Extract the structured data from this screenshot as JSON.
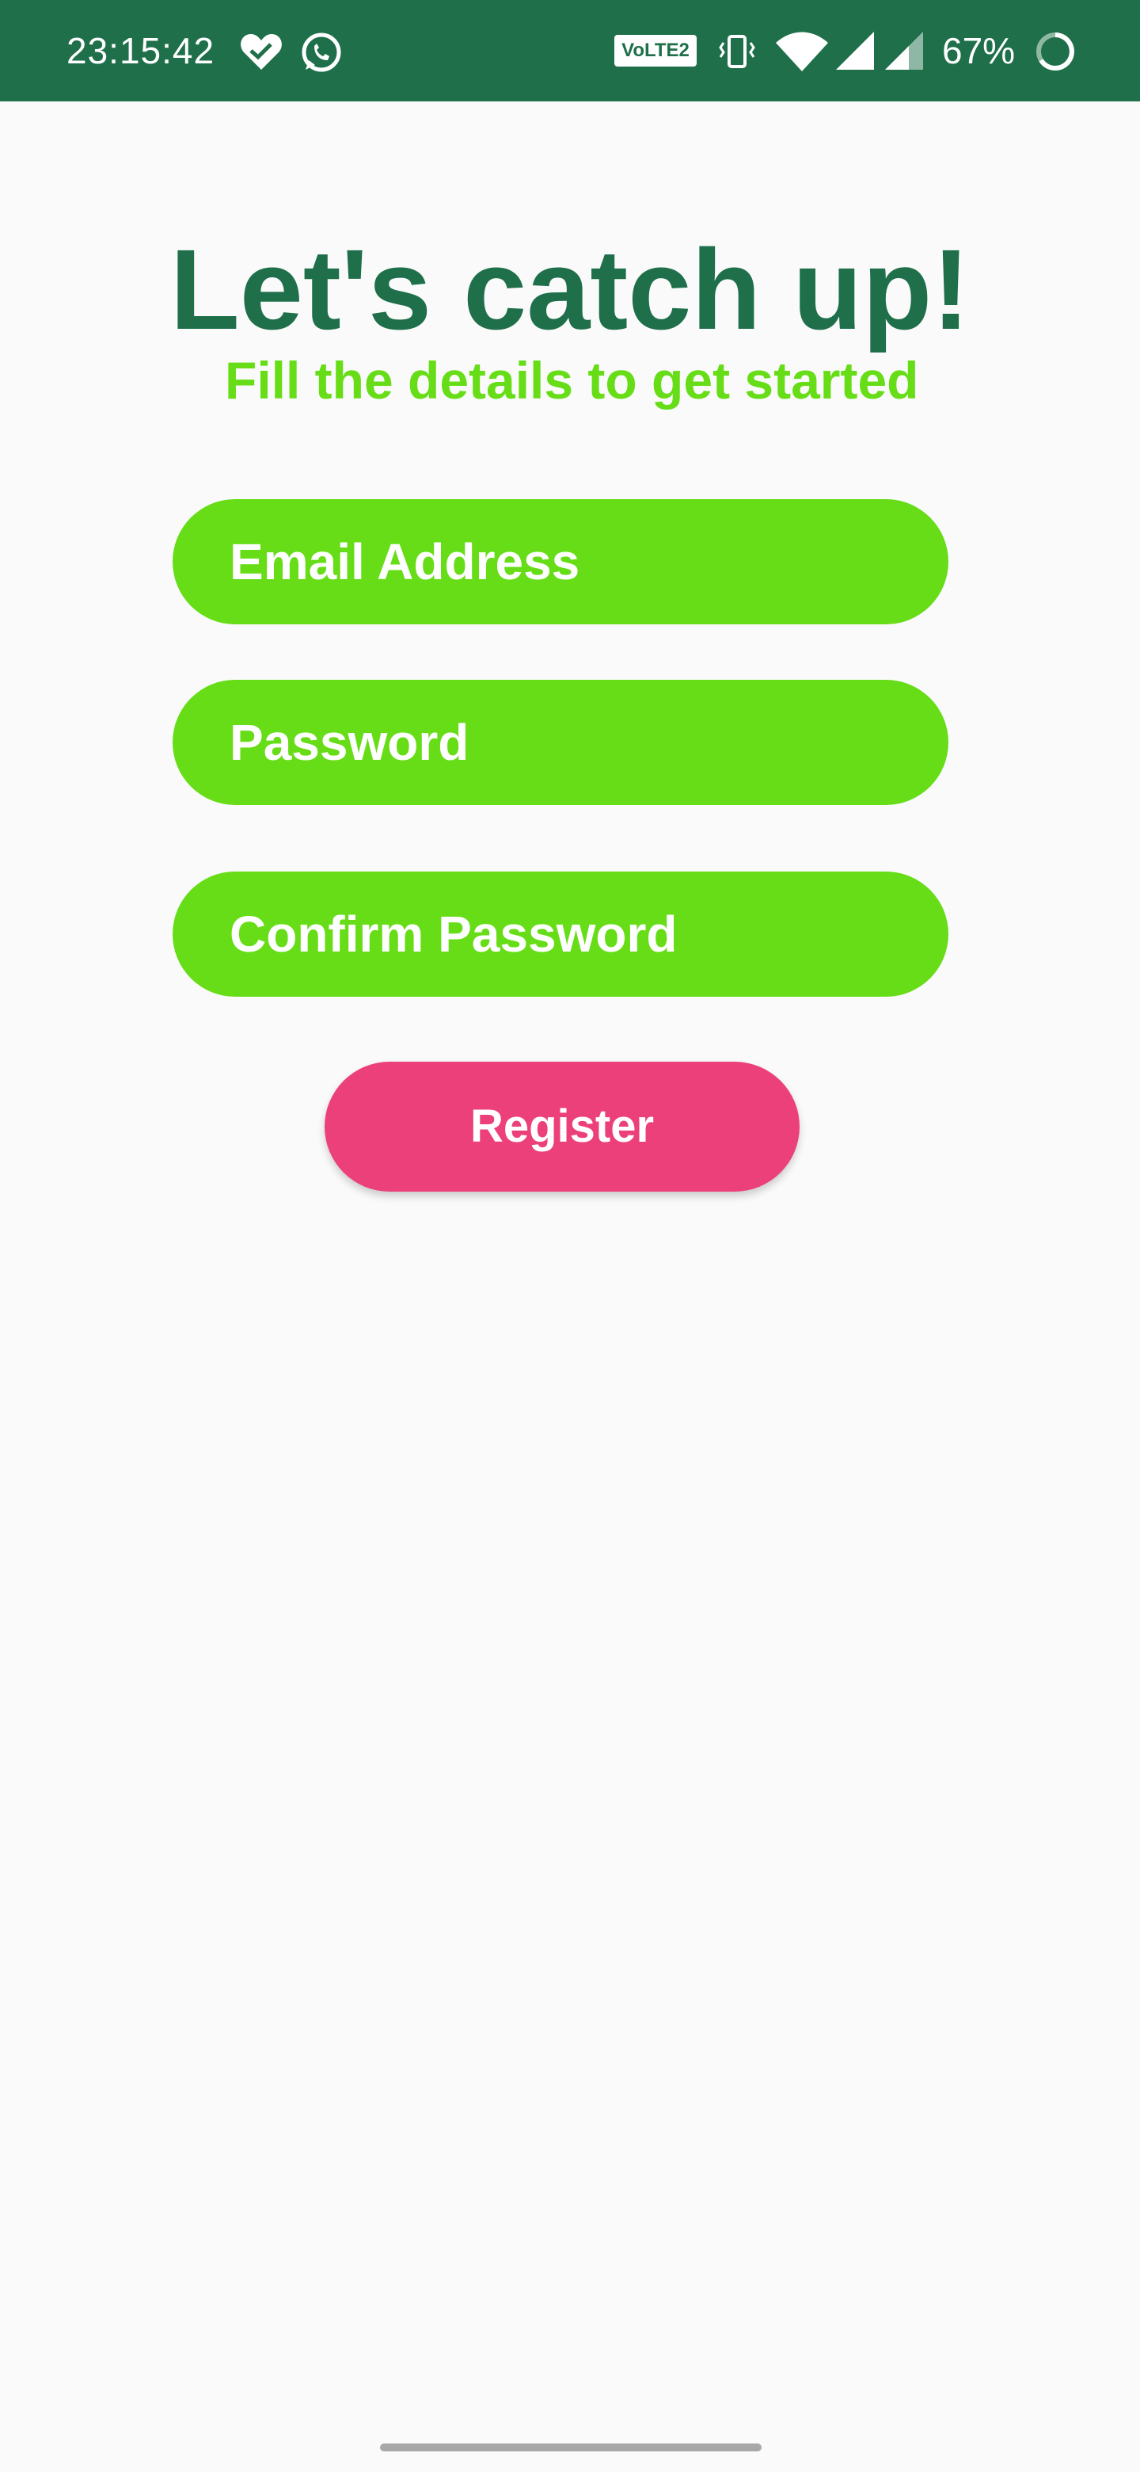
{
  "status_bar": {
    "time": "23:15:42",
    "volte_label": "VoLTE2",
    "battery_percent": "67%",
    "icons": [
      "heart-check-icon",
      "whatsapp-icon",
      "vibrate-icon",
      "wifi-icon",
      "signal-icon",
      "signal-icon",
      "battery-ring-icon"
    ],
    "background_color": "#1e6f4a"
  },
  "header": {
    "title": "Let's catch up!",
    "subtitle": "Fill the details to get started"
  },
  "form": {
    "email_placeholder": "Email Address",
    "password_placeholder": "Password",
    "confirm_password_placeholder": "Confirm Password",
    "register_label": "Register"
  },
  "colors": {
    "primary_dark_green": "#1e6f4a",
    "field_green": "#66dd16",
    "register_pink": "#ec407a",
    "background": "#fafafa"
  }
}
